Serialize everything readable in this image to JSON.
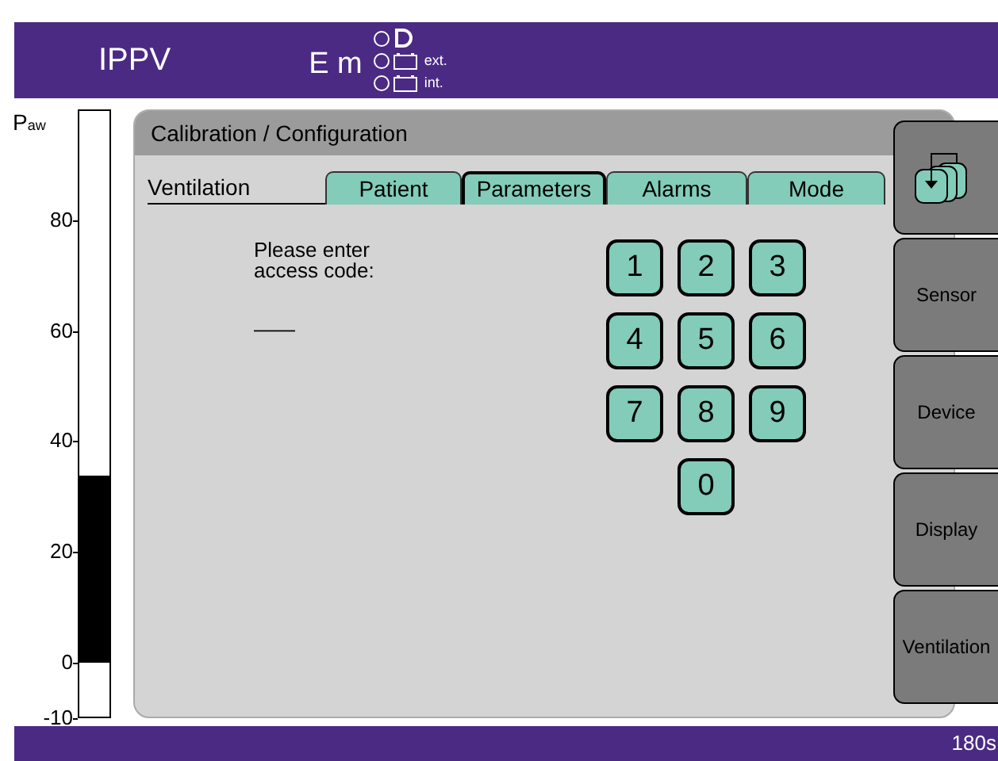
{
  "header": {
    "mode": "IPPV",
    "status": "E m",
    "indicators": [
      {
        "kind": "plug",
        "lit": false
      },
      {
        "kind": "battery",
        "lit": false,
        "label": "ext."
      },
      {
        "kind": "battery",
        "lit": false,
        "label": "int."
      }
    ]
  },
  "pressure_gauge": {
    "label": "P",
    "label_sub": "aw",
    "ticks": [
      "80",
      "60",
      "40",
      "20",
      "0",
      "-10"
    ]
  },
  "panel": {
    "title": "Calibration / Configuration",
    "section": "Ventilation",
    "tabs": [
      {
        "label": "Patient",
        "selected": false
      },
      {
        "label": "Parameters",
        "selected": true
      },
      {
        "label": "Alarms",
        "selected": false
      },
      {
        "label": "Mode",
        "selected": false
      }
    ],
    "prompt": "Please enter\naccess code:",
    "code": "——",
    "keypad": [
      "1",
      "2",
      "3",
      "4",
      "5",
      "6",
      "7",
      "8",
      "9",
      "0"
    ]
  },
  "sidebar": {
    "items": [
      {
        "kind": "icon"
      },
      {
        "kind": "text",
        "label": "Sensor"
      },
      {
        "kind": "text",
        "label": "Device"
      },
      {
        "kind": "text",
        "label": "Display"
      },
      {
        "kind": "text",
        "label": "Ventilation"
      }
    ]
  },
  "status_bar": {
    "time": "180s"
  }
}
